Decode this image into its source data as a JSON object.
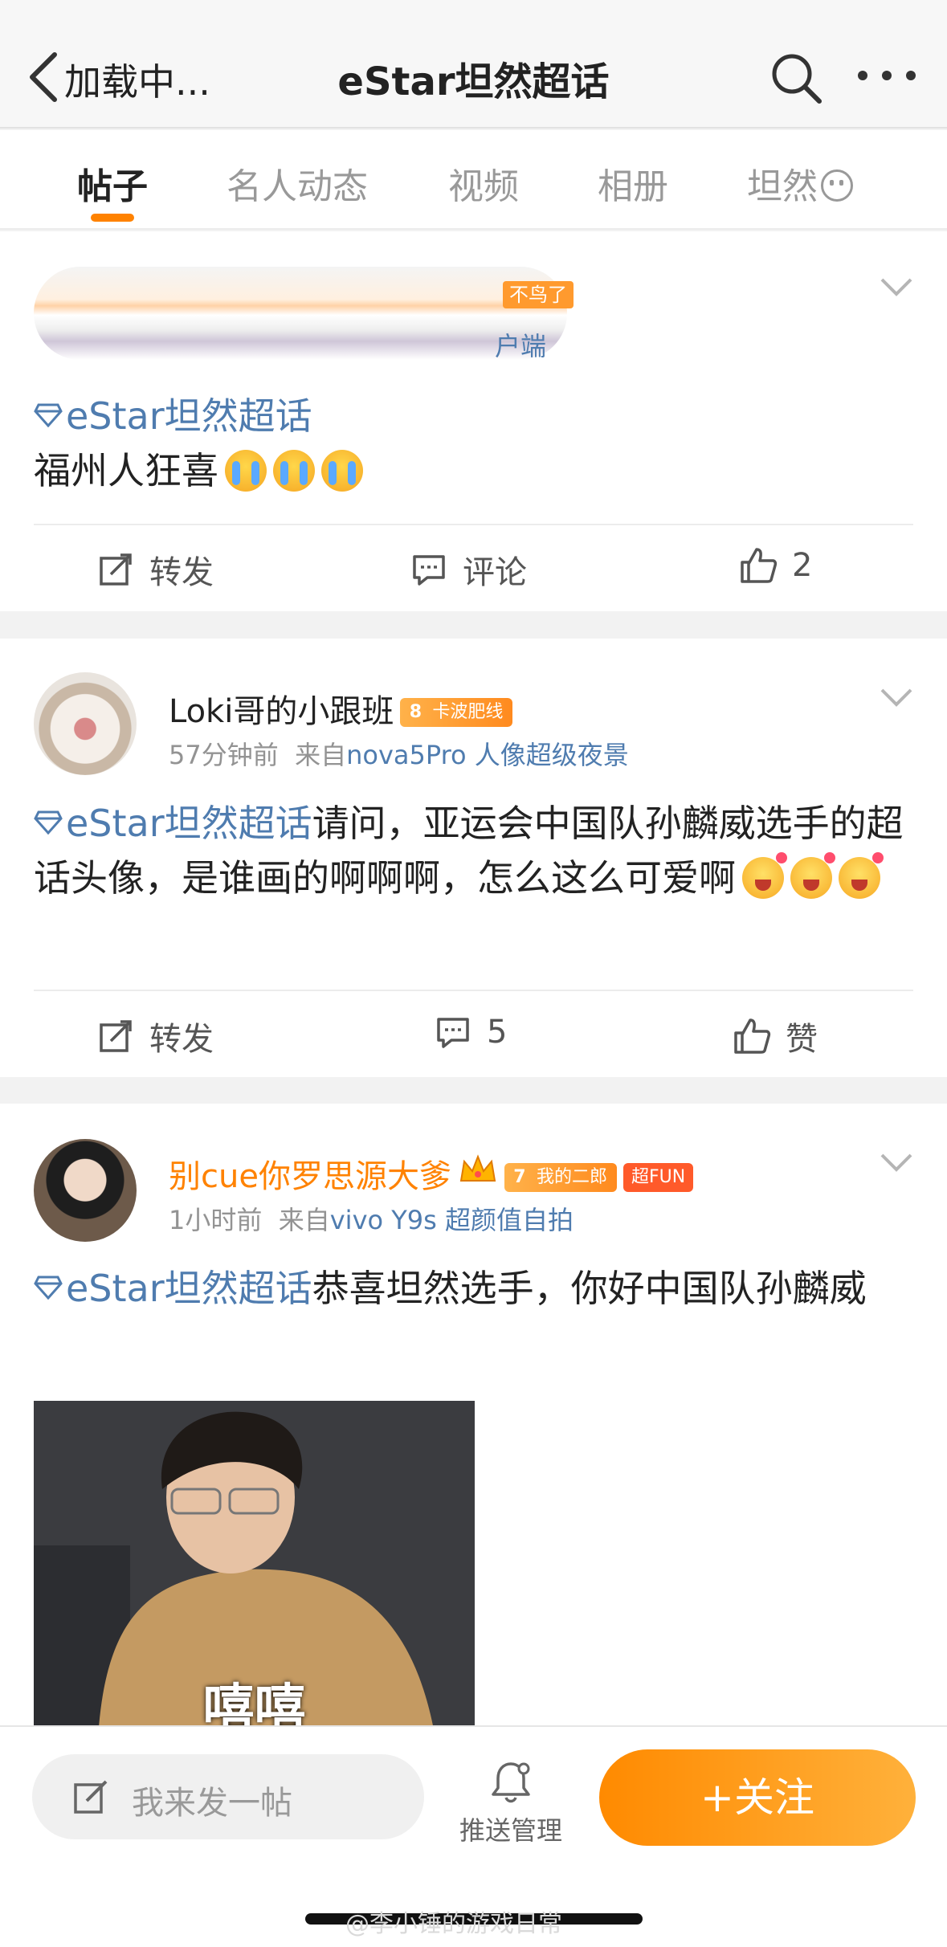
{
  "nav": {
    "back_label": "加载中...",
    "title": "eStar坦然超话"
  },
  "tabs": [
    {
      "label": "帖子",
      "active": true
    },
    {
      "label": "名人动态",
      "active": false
    },
    {
      "label": "视频",
      "active": false
    },
    {
      "label": "相册",
      "active": false
    },
    {
      "label": "坦然",
      "active": false
    }
  ],
  "posts": [
    {
      "header_tag": "不鸟了",
      "header_sub": "户端",
      "topic": "eStar坦然超话",
      "text": "福州人狂喜",
      "emojis": [
        "crying-face",
        "crying-face",
        "crying-face"
      ],
      "actions": {
        "repost": "转发",
        "comment": "评论",
        "like": "2"
      }
    },
    {
      "user": "Loki哥的小跟班",
      "badge_level": "8",
      "badge_label": "卡波肥线",
      "time": "57分钟前",
      "source_prefix": "来自",
      "source": "nova5Pro 人像超级夜景",
      "topic": "eStar坦然超话",
      "text": "请问，亚运会中国队孙麟威选手的超话头像，是谁画的啊啊啊，怎么这么可爱啊",
      "emojis": [
        "love-face",
        "love-face",
        "love-face"
      ],
      "actions": {
        "repost": "转发",
        "comment": "5",
        "like": "赞"
      }
    },
    {
      "user": "别cue你罗思源大爹",
      "badge_level": "7",
      "badge_label": "我的二郎",
      "badge2": "超FUN",
      "time": "1小时前",
      "source_prefix": "来自",
      "source": "vivo Y9s 超颜值自拍",
      "topic": "eStar坦然超话",
      "text": "恭喜坦然选手，你好中国队孙麟威",
      "image_caption": "嘻嘻"
    }
  ],
  "bottom": {
    "compose_placeholder": "我来发一帖",
    "push_label": "推送管理",
    "follow_label": "+关注"
  },
  "watermark": "@李小锤的游戏日常",
  "colors": {
    "accent": "#ff8200",
    "link": "#4f7caf",
    "username_vip": "#ff8200"
  }
}
